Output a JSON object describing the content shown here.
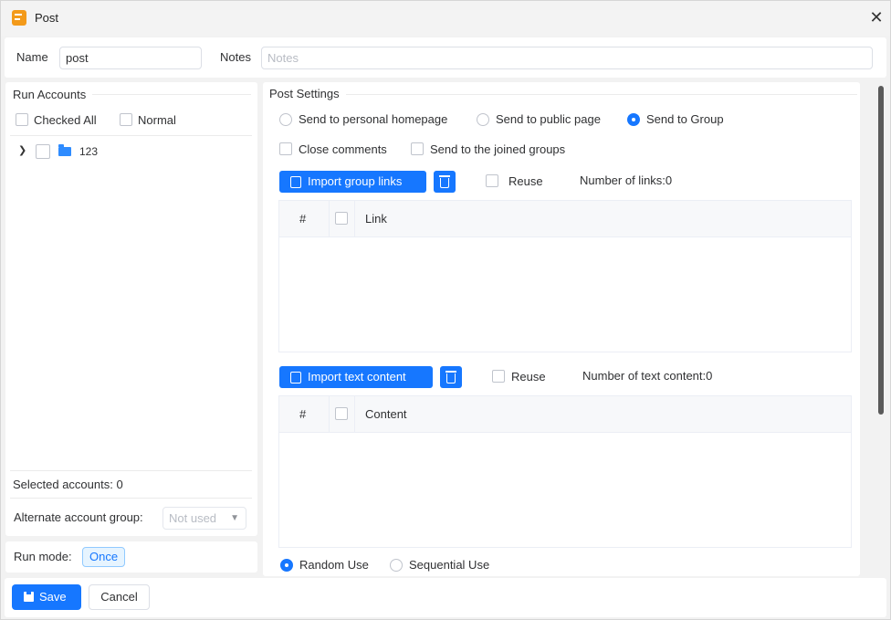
{
  "window": {
    "title": "Post",
    "app_icon": "post-app-icon",
    "close_icon": "close-icon"
  },
  "form": {
    "name_label": "Name",
    "name_value": "post",
    "notes_label": "Notes",
    "notes_placeholder": "Notes"
  },
  "run_accounts": {
    "title": "Run Accounts",
    "checked_all_label": "Checked All",
    "normal_label": "Normal",
    "tree": [
      {
        "label": "123",
        "icon": "folder-icon",
        "expanded": false,
        "checked": false
      }
    ],
    "selected_accounts_text": "Selected accounts: 0",
    "alternate_group_label": "Alternate account group:",
    "alternate_group_value": "Not used"
  },
  "run_mode": {
    "label": "Run mode:",
    "value": "Once"
  },
  "post_settings": {
    "title": "Post Settings",
    "send_options": [
      {
        "label": "Send to personal homepage",
        "selected": false
      },
      {
        "label": "Send to public page",
        "selected": false
      },
      {
        "label": "Send to Group",
        "selected": true
      }
    ],
    "close_comments_label": "Close comments",
    "send_joined_groups_label": "Send to the joined groups",
    "links": {
      "import_button": "Import group links",
      "reuse_label": "Reuse",
      "count_text": "Number of links:0",
      "columns": [
        "#",
        "",
        "Link"
      ],
      "rows": []
    },
    "content": {
      "import_button": "Import text content",
      "reuse_label": "Reuse",
      "count_text": "Number of text content:0",
      "columns": [
        "#",
        "",
        "Content"
      ],
      "rows": []
    },
    "use_modes": [
      {
        "label": "Random Use",
        "selected": true
      },
      {
        "label": "Sequential Use",
        "selected": false
      }
    ]
  },
  "footer": {
    "save_label": "Save",
    "cancel_label": "Cancel"
  },
  "colors": {
    "accent": "#1677ff",
    "app_icon": "#f39a1a",
    "folder": "#2f8cff"
  }
}
